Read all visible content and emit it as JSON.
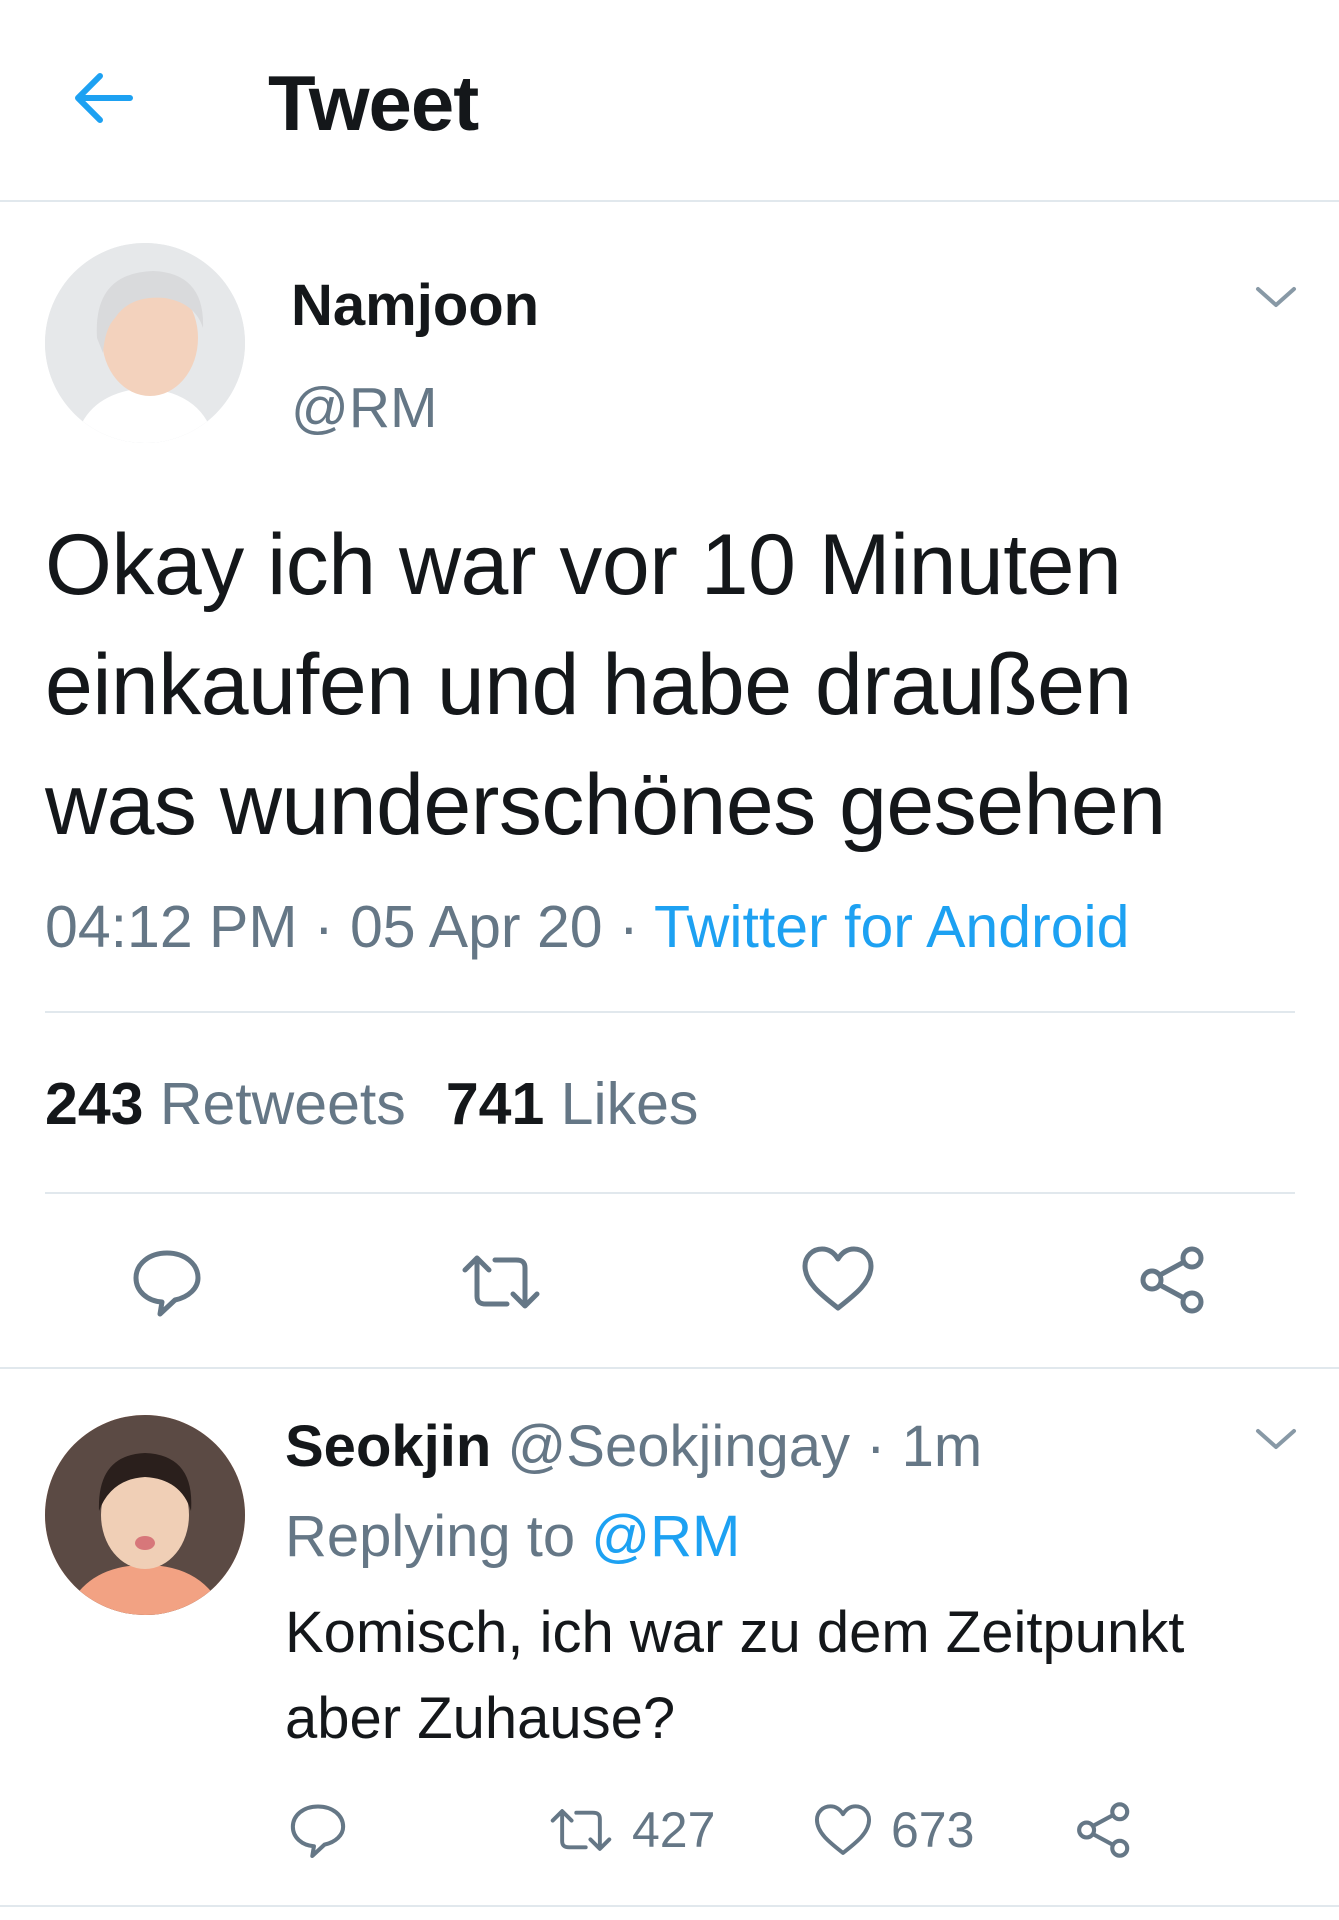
{
  "header": {
    "title": "Tweet",
    "back_icon": "arrow-left-icon"
  },
  "tweet": {
    "author_name": "Namjoon",
    "author_handle": "@RM",
    "text_lines": [
      "Okay ich war vor 10 Minuten",
      "einkaufen und habe draußen",
      "was wunderschönes gesehen"
    ],
    "time": "04:12 PM",
    "sep1": " · ",
    "date": "05 Apr 20",
    "sep2": " · ",
    "source": "Twitter for Android",
    "retweets": "243",
    "retweets_label": "Retweets",
    "likes": "741",
    "likes_label": "Likes"
  },
  "reply": {
    "author_name": "Seokjin",
    "author_handle": "@Seokjingay",
    "time": " · 1m",
    "replying_prefix": "Replying to ",
    "replying_to": "@RM",
    "text_lines": [
      "Komisch, ich war zu dem Zeitpunkt",
      "aber Zuhause?"
    ],
    "retweets": "427",
    "likes": "673"
  },
  "colors": {
    "accent": "#1da1f2",
    "secondary_text": "#657786",
    "divider": "#e1e8ed",
    "primary_text": "#14171a"
  }
}
